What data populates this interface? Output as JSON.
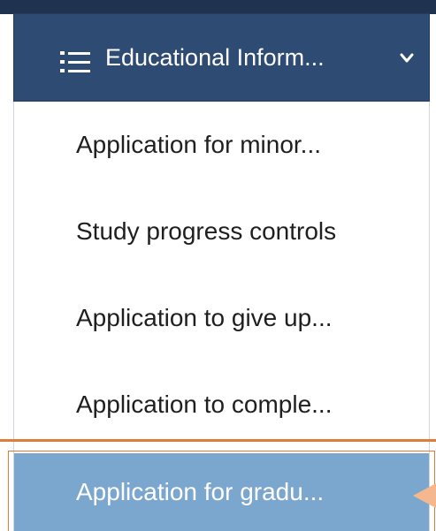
{
  "menu": {
    "title": "Educational Inform...",
    "icon": "list-icon",
    "expand_icon": "chevron-down-icon",
    "items": [
      {
        "label": "Application for minor..."
      },
      {
        "label": "Study progress controls"
      },
      {
        "label": "Application to give up..."
      },
      {
        "label": "Application to comple..."
      },
      {
        "label": "Application for gradu..."
      }
    ],
    "selected_index": 4
  },
  "colors": {
    "header_bg": "#2e4b73",
    "selected_bg": "#7ba7cf",
    "annotation": "#e07b39"
  },
  "annotation": {
    "pointer_icon": "arrow-left-icon"
  }
}
